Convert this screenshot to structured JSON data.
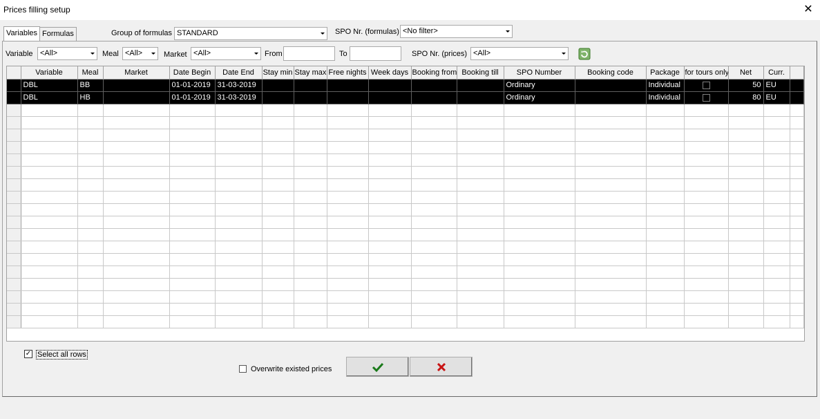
{
  "window": {
    "title": "Prices filling setup",
    "close_glyph": "✕"
  },
  "tabs": [
    {
      "label": "Variables",
      "active": true
    },
    {
      "label": "Formulas",
      "active": false
    }
  ],
  "formula_bar": {
    "group_label": "Group of formulas",
    "group_value": "STANDARD",
    "spo_formulas_label": "SPO Nr. (formulas)",
    "spo_formulas_value": "<No filter>"
  },
  "filters": {
    "variable_label": "Variable",
    "variable_value": "<All>",
    "meal_label": "Meal",
    "meal_value": "<All>",
    "market_label": "Market",
    "market_value": "<All>",
    "from_label": "From",
    "from_value": "",
    "to_label": "To",
    "to_value": "",
    "spo_prices_label": "SPO Nr. (prices)",
    "spo_prices_value": "<All>",
    "refresh_icon": "refresh-icon"
  },
  "grid": {
    "columns": [
      "Variable",
      "Meal",
      "Market",
      "Date Begin",
      "Date End",
      "Stay min",
      "Stay max",
      "Free nights",
      "Week days",
      "Booking from",
      "Booking till",
      "SPO Number",
      "Booking code",
      "Package",
      "for tours only",
      "Net",
      "Curr."
    ],
    "rows": [
      {
        "variable": "DBL",
        "meal": "BB",
        "market": "",
        "date_begin": "01-01-2019",
        "date_end": "31-03-2019",
        "stay_min": "",
        "stay_max": "",
        "free_nights": "",
        "week_days": "",
        "booking_from": "",
        "booking_till": "",
        "spo_number": "Ordinary",
        "booking_code": "",
        "package": "Individual",
        "tours_only": false,
        "net": "50",
        "curr": "EU"
      },
      {
        "variable": "DBL",
        "meal": "HB",
        "market": "",
        "date_begin": "01-01-2019",
        "date_end": "31-03-2019",
        "stay_min": "",
        "stay_max": "",
        "free_nights": "",
        "week_days": "",
        "booking_from": "",
        "booking_till": "",
        "spo_number": "Ordinary",
        "booking_code": "",
        "package": "Individual",
        "tours_only": false,
        "net": "80",
        "curr": "EU"
      }
    ],
    "empty_rows": 18
  },
  "bottom": {
    "select_all_label": "Select all rows",
    "select_all_checked": true,
    "overwrite_label": "Overwrite existed prices",
    "overwrite_checked": false,
    "ok_icon": "checkmark-icon",
    "cancel_icon": "cross-icon",
    "ok_color": "#1a7a1a",
    "cancel_color": "#c81414"
  }
}
